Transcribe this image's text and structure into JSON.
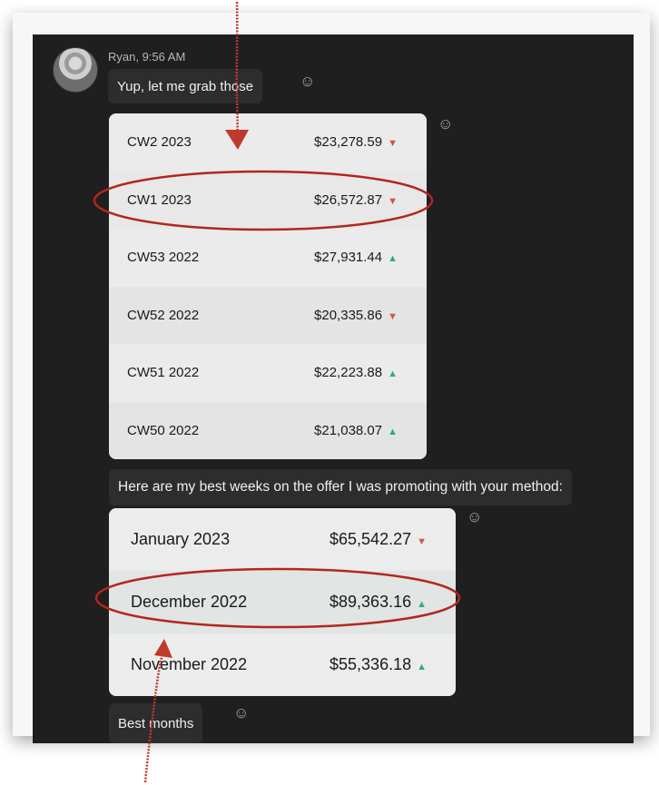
{
  "message": {
    "sender_line": "Ryan, 9:56 AM",
    "bubble1": "Yup, let me grab those",
    "bubble2": "Here are my best weeks on the offer I was promoting with your method:",
    "bubble3": "Best months"
  },
  "weekly": [
    {
      "label": "CW2 2023",
      "value": "$23,278.59",
      "trend": "down"
    },
    {
      "label": "CW1 2023",
      "value": "$26,572.87",
      "trend": "down"
    },
    {
      "label": "CW53 2022",
      "value": "$27,931.44",
      "trend": "up"
    },
    {
      "label": "CW52 2022",
      "value": "$20,335.86",
      "trend": "down"
    },
    {
      "label": "CW51 2022",
      "value": "$22,223.88",
      "trend": "up"
    },
    {
      "label": "CW50 2022",
      "value": "$21,038.07",
      "trend": "up"
    }
  ],
  "monthly": [
    {
      "label": "January 2023",
      "value": "$65,542.27",
      "trend": "down"
    },
    {
      "label": "December 2022",
      "value": "$89,363.16",
      "trend": "up"
    },
    {
      "label": "November 2022",
      "value": "$55,336.18",
      "trend": "up"
    }
  ],
  "icons": {
    "reaction": "smiley-icon",
    "trend_up": "triangle-up-icon",
    "trend_down": "triangle-down-icon"
  },
  "colors": {
    "annotation": "#c0392b",
    "trend_up": "#2ea98a",
    "trend_down": "#d2524a",
    "chat_bg": "#1f1f1f"
  }
}
